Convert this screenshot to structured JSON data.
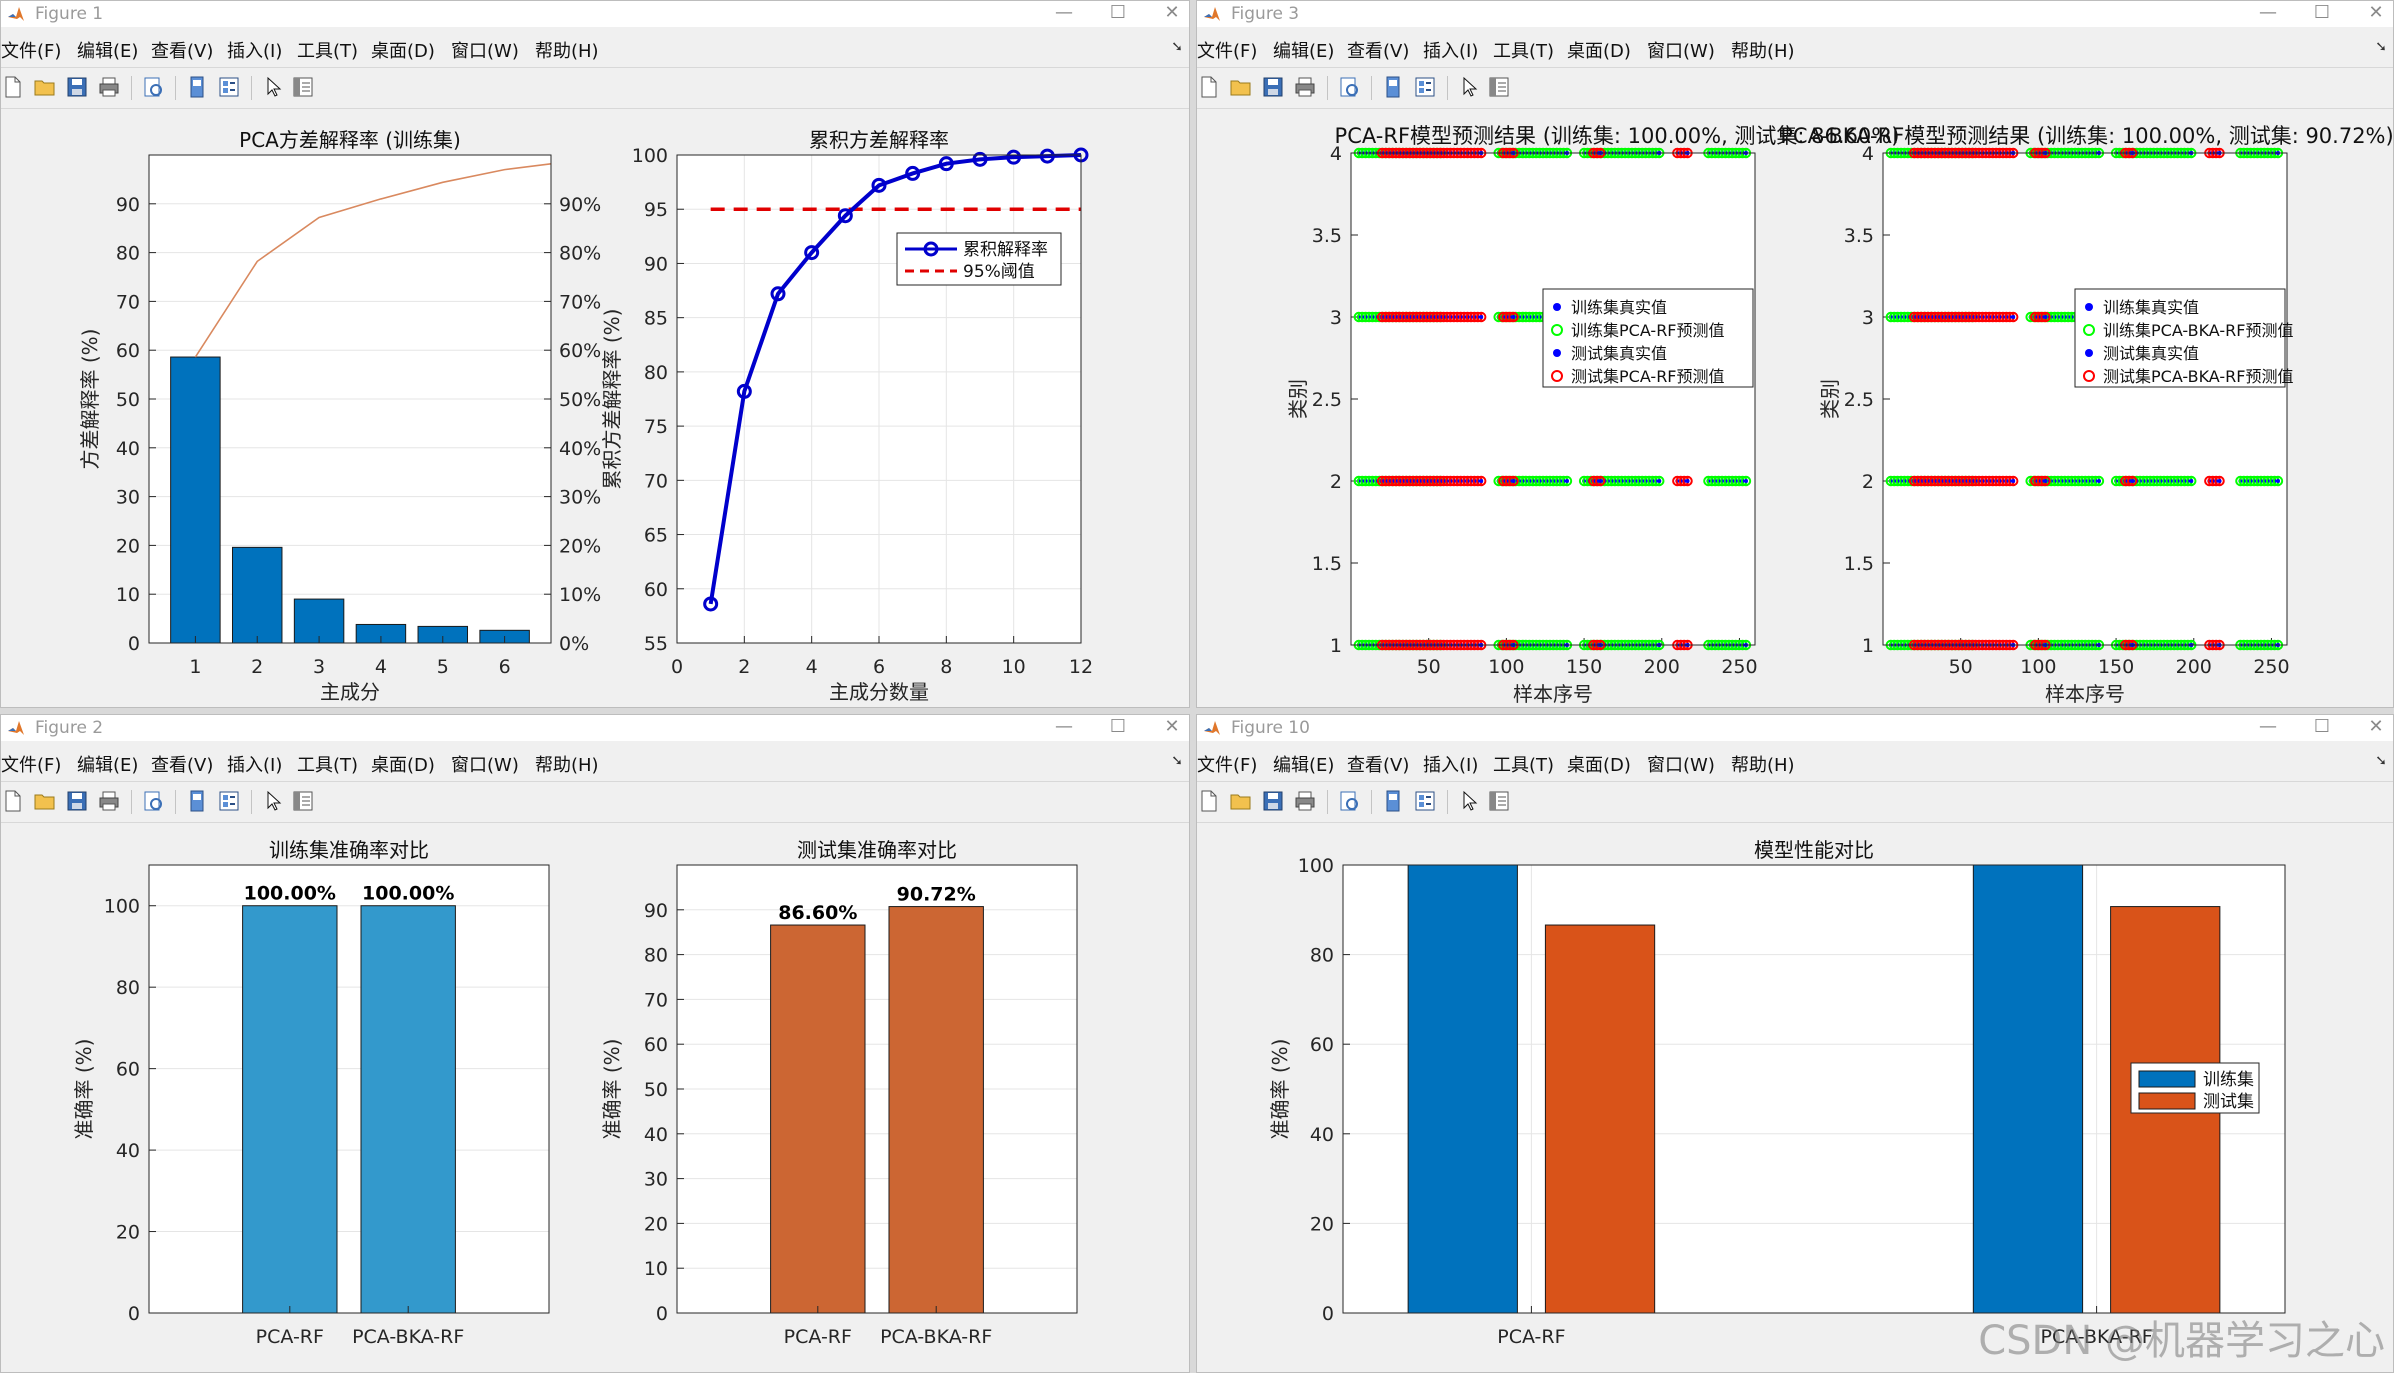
{
  "colors": {
    "blue": "#0072bd",
    "orange": "#d95319",
    "steel": "#3399cc",
    "rust": "#cc6633",
    "line_blue": "#0000cc",
    "threshold_red": "#e00000",
    "grid": "#e5e5e5",
    "marker_green": "#00ff00",
    "marker_red": "#ff0000",
    "marker_blue": "#0000ff"
  },
  "menu": [
    "文件(F)",
    "编辑(E)",
    "查看(V)",
    "插入(I)",
    "工具(T)",
    "桌面(D)",
    "窗口(W)",
    "帮助(H)"
  ],
  "toolbar_icons": [
    "new-file-icon",
    "open-folder-icon",
    "save-icon",
    "print-icon",
    "print-preview-icon",
    "link-plot-icon",
    "insert-colorbar-icon",
    "edit-plot-pointer-icon",
    "property-inspector-icon"
  ],
  "window_buttons": {
    "minimize": "—",
    "maximize": "☐",
    "close": "✕"
  },
  "figures": [
    {
      "id": "fig1",
      "title": "Figure 1"
    },
    {
      "id": "fig3",
      "title": "Figure 3"
    },
    {
      "id": "fig2",
      "title": "Figure 2"
    },
    {
      "id": "fig10",
      "title": "Figure 10"
    }
  ],
  "watermark": "CSDN @机器学习之心",
  "chart_data": [
    {
      "figure": "Figure 1",
      "type": "bar",
      "title": "PCA方差解释率 (训练集)",
      "xlabel": "主成分",
      "ylabel": "方差解释率 (%)",
      "categories": [
        "1",
        "2",
        "3",
        "4",
        "5",
        "6"
      ],
      "values": [
        58.6,
        19.6,
        9.0,
        3.8,
        3.4,
        2.6
      ],
      "ylim": [
        0,
        100
      ],
      "yticks": [
        0,
        10,
        20,
        30,
        40,
        50,
        60,
        70,
        80,
        90
      ],
      "pareto_line": {
        "values": [
          58.6,
          78.2,
          87.2,
          91.0,
          94.4,
          97.0
        ]
      },
      "right_axis": {
        "ylim": [
          0,
          100
        ],
        "ticklabels": [
          "0%",
          "10%",
          "20%",
          "30%",
          "40%",
          "50%",
          "60%",
          "70%",
          "80%",
          "90%"
        ]
      }
    },
    {
      "figure": "Figure 1",
      "type": "line",
      "title": "累积方差解释率",
      "xlabel": "主成分数量",
      "ylabel": "累积方差解释率 (%)",
      "x": [
        1,
        2,
        3,
        4,
        5,
        6,
        7,
        8,
        9,
        10,
        11,
        12
      ],
      "series": [
        {
          "name": "累积解释率",
          "values": [
            58.6,
            78.2,
            87.2,
            91.0,
            94.4,
            97.2,
            98.3,
            99.2,
            99.6,
            99.8,
            99.9,
            100.0
          ]
        },
        {
          "name": "95%阈值",
          "values": [
            95,
            95
          ]
        }
      ],
      "xlim": [
        0,
        12
      ],
      "ylim": [
        55,
        100
      ],
      "xticks": [
        0,
        2,
        4,
        6,
        8,
        10,
        12
      ],
      "yticks": [
        55,
        60,
        65,
        70,
        75,
        80,
        85,
        90,
        95,
        100
      ],
      "legend": "right-upper-middle"
    },
    {
      "figure": "Figure 3",
      "type": "scatter",
      "title": "PCA-RF模型预测结果 (训练集: 100.00%, 测试集: 86.60%)",
      "xlabel": "样本序号",
      "ylabel": "类别",
      "xlim": [
        0,
        260
      ],
      "ylim": [
        1,
        4
      ],
      "xticks": [
        50,
        100,
        150,
        200,
        250
      ],
      "yticks": [
        1,
        1.5,
        2,
        2.5,
        3,
        3.5,
        4
      ],
      "yticklabels": [
        "1",
        "1.5",
        "2",
        "2.5",
        "3",
        "3.5",
        "4"
      ],
      "legend_entries": [
        "训练集真实值",
        "训练集PCA-RF预测值",
        "测试集真实值",
        "测试集PCA-RF预测值"
      ],
      "legend": "right-middle",
      "segments": {
        "train_ranges": [
          [
            5,
            58
          ],
          [
            95,
            140
          ],
          [
            150,
            200
          ],
          [
            230,
            255
          ]
        ],
        "test_ranges": [
          [
            20,
            85
          ],
          [
            98,
            106
          ],
          [
            156,
            162
          ],
          [
            210,
            218
          ]
        ],
        "levels": [
          1,
          2,
          3,
          4
        ]
      }
    },
    {
      "figure": "Figure 3",
      "type": "scatter",
      "title": "PCA-BKA-RF模型预测结果 (训练集: 100.00%, 测试集: 90.72%)",
      "xlabel": "样本序号",
      "ylabel": "类别",
      "xlim": [
        0,
        260
      ],
      "ylim": [
        1,
        4
      ],
      "xticks": [
        50,
        100,
        150,
        200,
        250
      ],
      "yticks": [
        1,
        1.5,
        2,
        2.5,
        3,
        3.5,
        4
      ],
      "yticklabels": [
        "1",
        "1.5",
        "2",
        "2.5",
        "3",
        "3.5",
        "4"
      ],
      "legend_entries": [
        "训练集真实值",
        "训练集PCA-BKA-RF预测值",
        "测试集真实值",
        "测试集PCA-BKA-RF预测值"
      ],
      "legend": "right-middle",
      "segments": {
        "train_ranges": [
          [
            5,
            58
          ],
          [
            95,
            140
          ],
          [
            150,
            200
          ],
          [
            230,
            255
          ]
        ],
        "test_ranges": [
          [
            20,
            85
          ],
          [
            98,
            106
          ],
          [
            156,
            162
          ],
          [
            210,
            218
          ]
        ],
        "levels": [
          1,
          2,
          3,
          4
        ]
      }
    },
    {
      "figure": "Figure 2",
      "type": "bar",
      "title": "训练集准确率对比",
      "ylabel": "准确率 (%)",
      "categories": [
        "PCA-RF",
        "PCA-BKA-RF"
      ],
      "values": [
        100,
        100
      ],
      "data_labels": [
        "100.00%",
        "100.00%"
      ],
      "ylim": [
        0,
        110
      ],
      "yticks": [
        0,
        20,
        40,
        60,
        80,
        100
      ]
    },
    {
      "figure": "Figure 2",
      "type": "bar",
      "title": "测试集准确率对比",
      "ylabel": "准确率 (%)",
      "categories": [
        "PCA-RF",
        "PCA-BKA-RF"
      ],
      "values": [
        86.6,
        90.72
      ],
      "data_labels": [
        "86.60%",
        "90.72%"
      ],
      "ylim": [
        0,
        100
      ],
      "yticks": [
        0,
        10,
        20,
        30,
        40,
        50,
        60,
        70,
        80,
        90
      ]
    },
    {
      "figure": "Figure 10",
      "type": "bar",
      "title": "模型性能对比",
      "ylabel": "准确率 (%)",
      "categories": [
        "PCA-RF",
        "PCA-BKA-RF"
      ],
      "series": [
        {
          "name": "训练集",
          "values": [
            100,
            100
          ]
        },
        {
          "name": "测试集",
          "values": [
            86.6,
            90.72
          ]
        }
      ],
      "ylim": [
        0,
        100
      ],
      "yticks": [
        0,
        20,
        40,
        60,
        80,
        100
      ],
      "legend": "right-middle"
    }
  ]
}
